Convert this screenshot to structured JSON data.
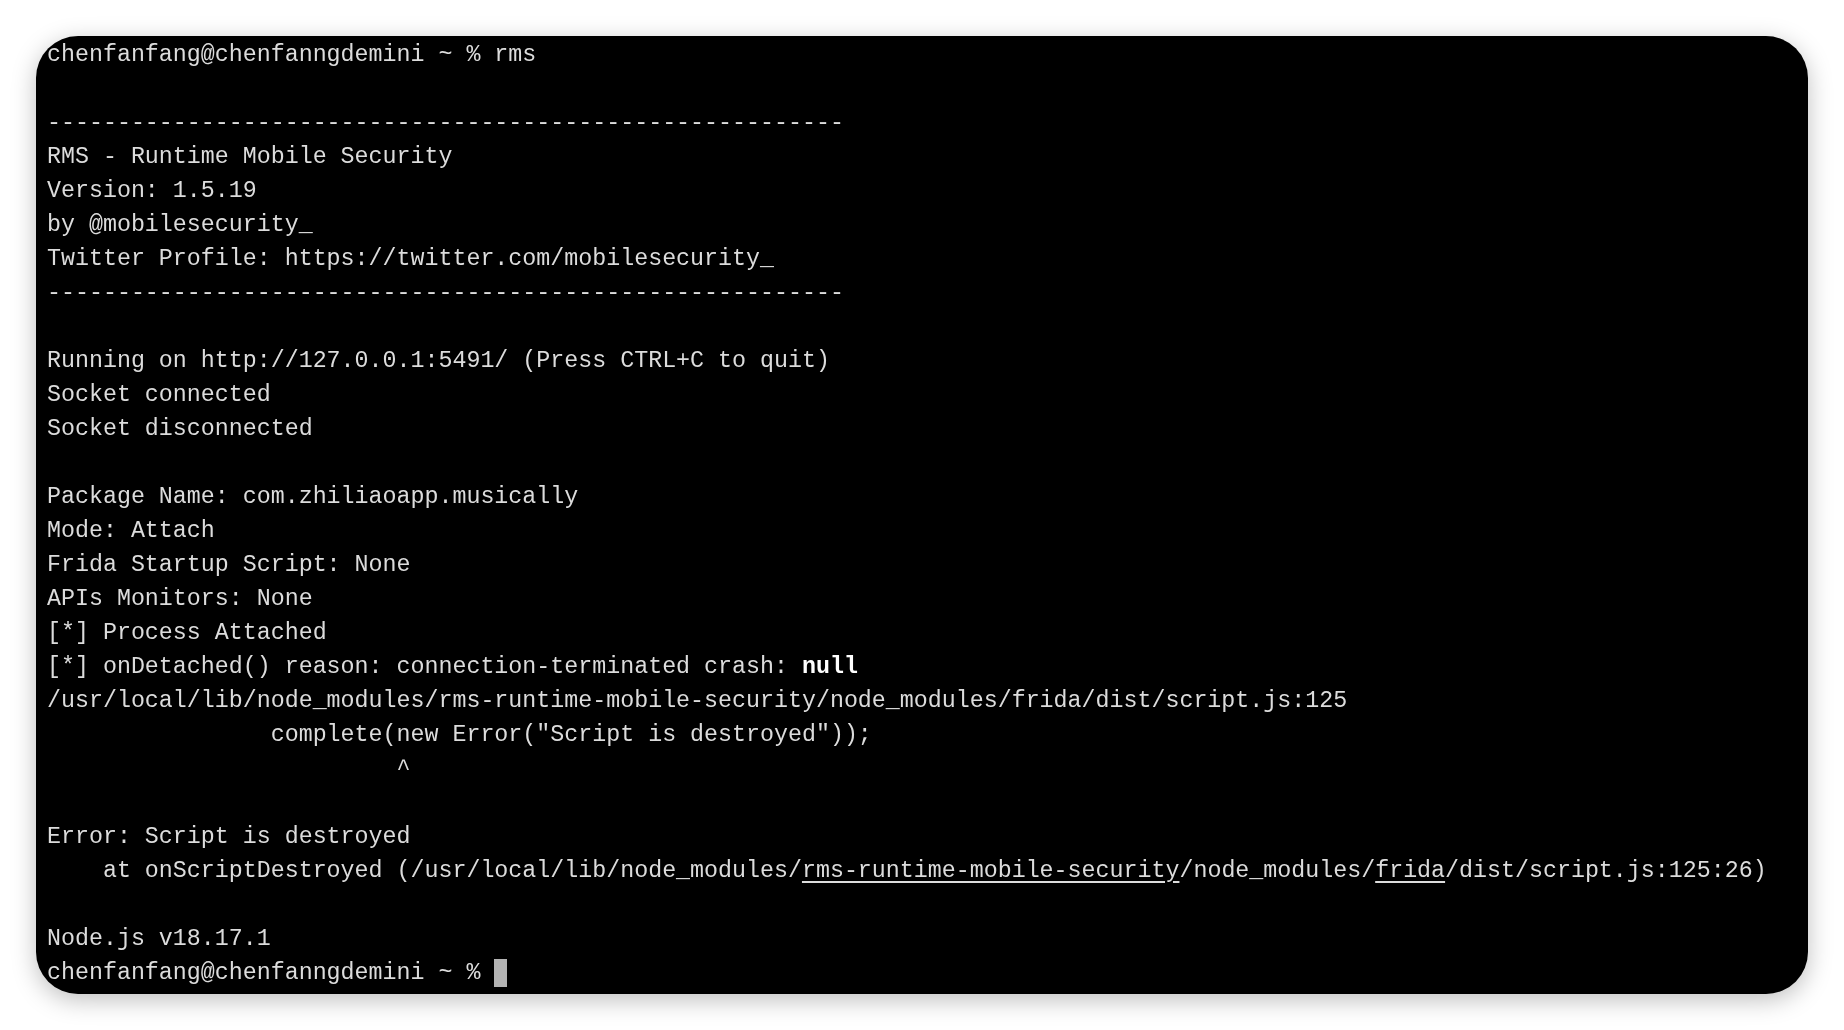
{
  "terminal": {
    "blocks": [
      [
        {
          "text": "chenfanfang@chenfanngdemini ~ % rms"
        }
      ],
      [
        {
          "text": "---------------------------------------------------------"
        },
        {
          "text": "RMS - Runtime Mobile Security"
        },
        {
          "text": "Version: 1.5.19"
        },
        {
          "text": "by @mobilesecurity_"
        },
        {
          "text": "Twitter Profile: https://twitter.com/mobilesecurity_"
        },
        {
          "text": "---------------------------------------------------------"
        }
      ],
      [
        {
          "text": "Running on http://127.0.0.1:5491/ (Press CTRL+C to quit)"
        },
        {
          "text": "Socket connected"
        },
        {
          "text": "Socket disconnected"
        }
      ],
      [
        {
          "text": "Package Name: com.zhiliaoapp.musically"
        },
        {
          "text": "Mode: Attach"
        },
        {
          "text": "Frida Startup Script: None"
        },
        {
          "text": "APIs Monitors: None"
        },
        {
          "text": "[*] Process Attached"
        },
        {
          "text": "[*] onDetached() reason: connection-terminated crash: **null**"
        },
        {
          "text": "/usr/local/lib/node_modules/rms-runtime-mobile-security/node_modules/frida/dist/script.js:125"
        },
        {
          "text": "                complete(new Error(\"Script is destroyed\"));"
        },
        {
          "text": "                         ^"
        }
      ],
      [
        {
          "text": "Error: Script is destroyed"
        },
        {
          "segments": [
            {
              "text": "    at onScriptDestroyed (/usr/local/lib/node_modules/",
              "underline": false
            },
            {
              "text": "rms-runtime-mobile-security",
              "underline": true
            },
            {
              "text": "/node_modules/",
              "underline": false
            },
            {
              "text": "frida",
              "underline": true
            },
            {
              "text": "/dist/script.js:125:26)",
              "underline": false
            }
          ]
        }
      ],
      [
        {
          "text": "Node.js v18.17.1"
        },
        {
          "text": "chenfanfang@chenfanngdemini ~ %",
          "cursor": true
        }
      ]
    ]
  }
}
